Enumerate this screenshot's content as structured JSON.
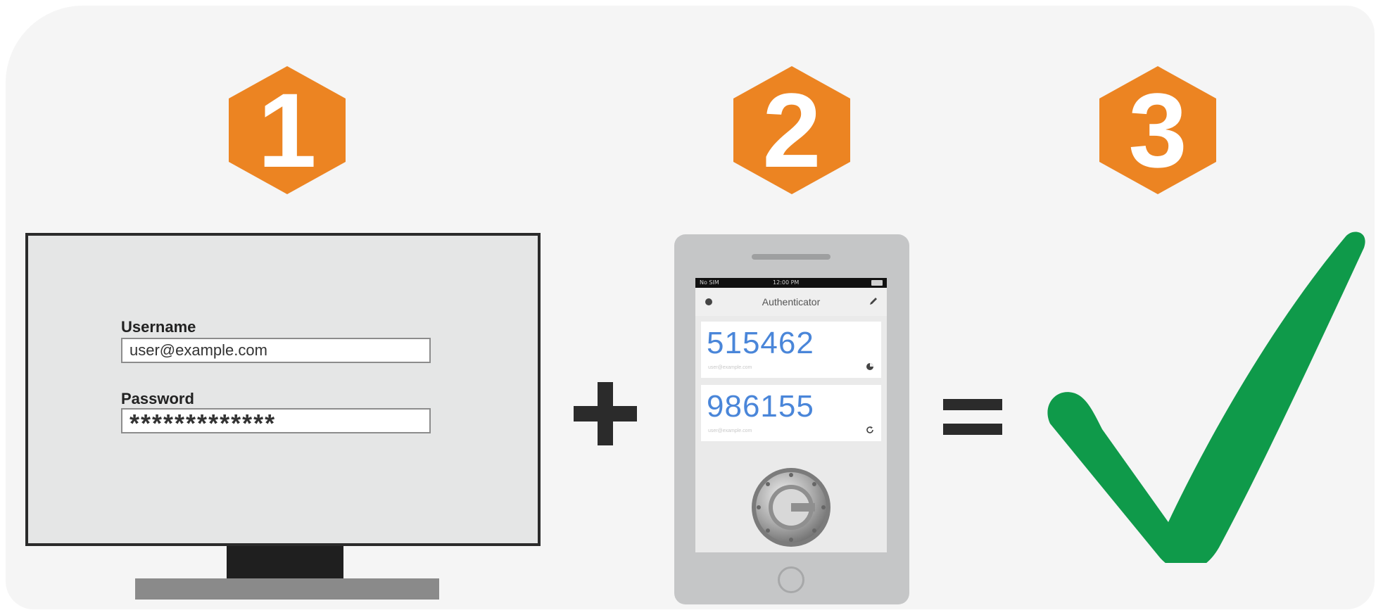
{
  "steps": {
    "step1": {
      "number": "1"
    },
    "step2": {
      "number": "2"
    },
    "step3": {
      "number": "3"
    }
  },
  "colors": {
    "badge": "#ec8422",
    "check": "#0f9a4a",
    "code": "#4a86d9"
  },
  "login_form": {
    "username_label": "Username",
    "username_value": "user@example.com",
    "password_label": "Password",
    "password_value": "*************"
  },
  "phone_app": {
    "status_carrier": "No SIM",
    "status_time": "12:00 PM",
    "title": "Authenticator",
    "codes": [
      {
        "value": "515462",
        "account": "user@example.com"
      },
      {
        "value": "986155",
        "account": "user@example.com"
      }
    ]
  },
  "icons": [
    "hexagon-badge",
    "monitor-icon",
    "plus-icon",
    "smartphone-icon",
    "equals-icon",
    "checkmark-icon",
    "info-icon",
    "edit-icon",
    "timer-icon",
    "refresh-icon",
    "authenticator-logo-icon"
  ]
}
